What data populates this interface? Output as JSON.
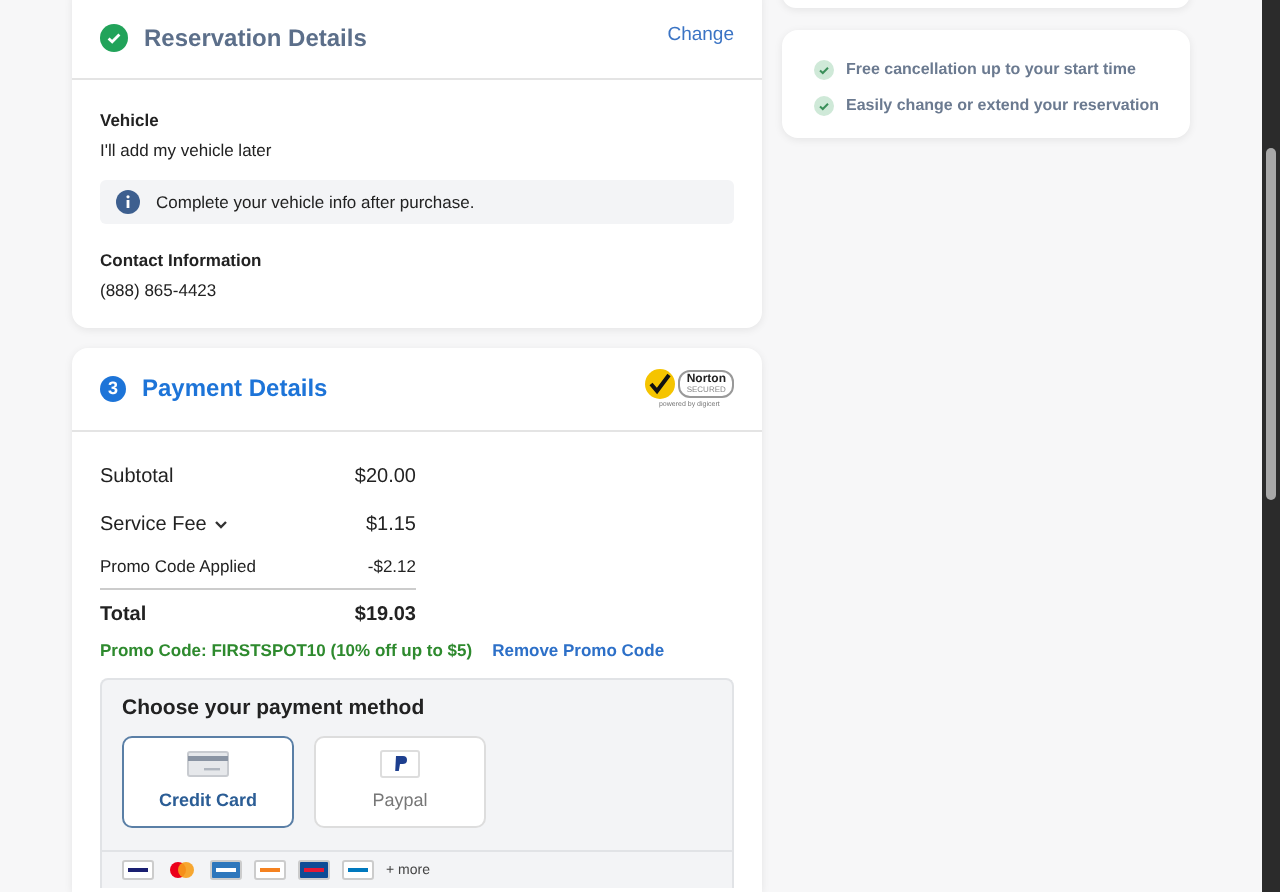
{
  "reservation": {
    "done": true,
    "title": "Reservation Details",
    "action": "Change",
    "vehicle_label": "Vehicle",
    "vehicle_value": "I'll add my vehicle later",
    "notice": "Complete your vehicle info after purchase.",
    "contact_label": "Contact Information",
    "contact_value": "(888) 865-4423"
  },
  "payment": {
    "step": "3",
    "done": false,
    "title": "Payment Details",
    "badge": {
      "name": "Norton",
      "sub": "SECURED",
      "powered": "powered by digicert"
    },
    "summary": [
      {
        "label": "Subtotal",
        "value": "$20.00",
        "kind": "large"
      },
      {
        "label": "Service Fee",
        "value": "$1.15",
        "kind": "expandable",
        "expanded": false
      },
      {
        "label": "Promo Code Applied",
        "value": "-$2.12",
        "kind": "small"
      },
      {
        "label": "Total",
        "value": "$19.03",
        "kind": "total"
      }
    ],
    "promo": {
      "text": "Promo Code: FIRSTSPOT10 (10% off up to $5)",
      "remove": "Remove Promo Code"
    },
    "method_title": "Choose your payment method",
    "methods": [
      {
        "label": "Credit Card",
        "kind": "card",
        "selected": true
      },
      {
        "label": "Paypal",
        "kind": "paypal",
        "selected": false
      }
    ],
    "more": "+ more"
  },
  "benefits": [
    {
      "text": "Free cancellation up to your start time"
    },
    {
      "text": "Easily change or extend your reservation"
    }
  ]
}
